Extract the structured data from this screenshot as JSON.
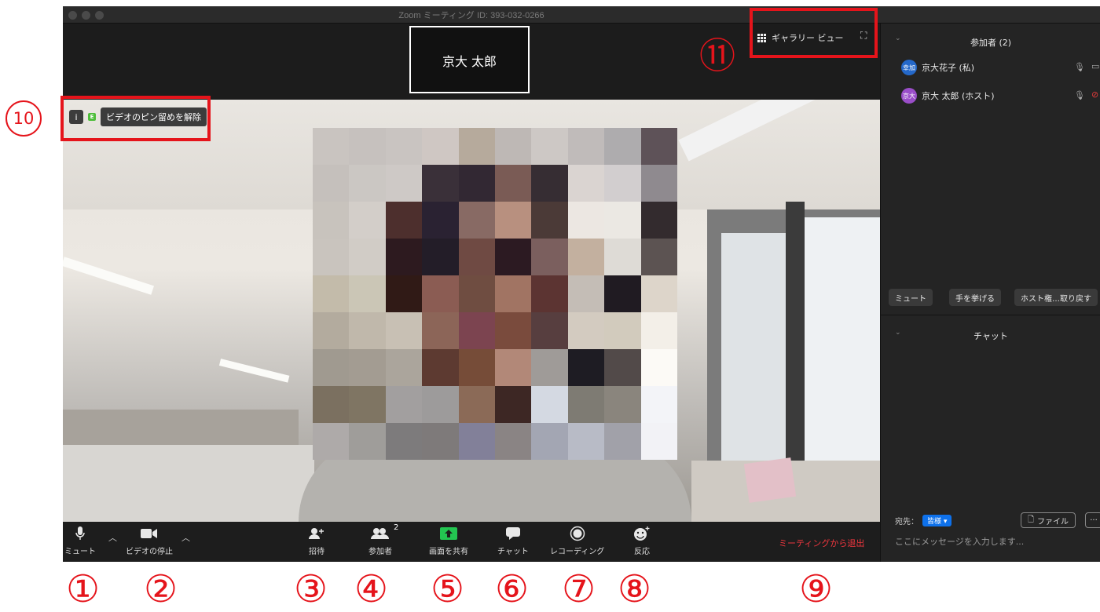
{
  "window": {
    "title": "Zoom ミーティング ID: 393-032-0266"
  },
  "speaker": {
    "name": "京大 太郎"
  },
  "view": {
    "gallery_label": "ギャラリー ビュー",
    "unpin_label": "ビデオのピン留めを解除",
    "encryption_badge": "E"
  },
  "toolbar": {
    "mute": "ミュート",
    "stop_video": "ビデオの停止",
    "invite": "招待",
    "participants": "参加者",
    "participants_count": "2",
    "share": "画面を共有",
    "chat": "チャット",
    "record": "レコーディング",
    "reactions": "反応",
    "leave": "ミーティングから退出"
  },
  "participants_panel": {
    "title": "参加者 (2)",
    "items": [
      {
        "avatar_text": "幸加",
        "name": "京大花子 (私)",
        "avatar_color": "#2468c9"
      },
      {
        "avatar_text": "京大",
        "name": "京大 太郎 (ホスト)",
        "avatar_color": "#9a4ec9"
      }
    ],
    "buttons": [
      "ミュート",
      "手を挙げる",
      "ホスト権…取り戻す"
    ]
  },
  "chat_panel": {
    "title": "チャット",
    "to_label": "宛先：",
    "to_value": "皆様",
    "file_button": "ファイル",
    "more_button": "···",
    "input_placeholder": "ここにメッセージを入力します..."
  },
  "annotations": {
    "numbers": [
      "①",
      "②",
      "③",
      "④",
      "⑤",
      "⑥",
      "⑦",
      "⑧",
      "⑨"
    ],
    "ten": "10",
    "eleven": "⑪"
  },
  "colors": {
    "annotation_red": "#e5141b",
    "leave_red": "#f0363e",
    "chat_to_blue": "#0e71eb"
  },
  "icons": {
    "mute": "microphone-icon",
    "video": "camera-icon",
    "invite": "add-person-icon",
    "participants": "people-icon",
    "share": "share-screen-icon",
    "chat": "speech-bubble-icon",
    "record": "record-icon",
    "reactions": "emoji-add-icon"
  }
}
